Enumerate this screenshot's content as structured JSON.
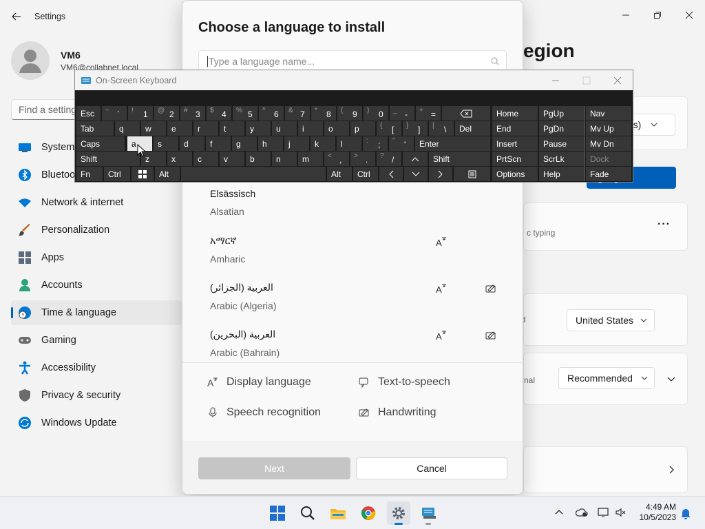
{
  "window": {
    "title": "Settings"
  },
  "user": {
    "name": "VM6",
    "email": "VM6@collabnet.local"
  },
  "search": {
    "placeholder": "Find a setting"
  },
  "sidebar": {
    "items": [
      {
        "label": "System",
        "icon": "system-icon",
        "color": "#0078d4"
      },
      {
        "label": "Bluetooth & devices",
        "icon": "bluetooth-icon",
        "color": "#0078d4"
      },
      {
        "label": "Network & internet",
        "icon": "wifi-icon",
        "color": "#0078d4"
      },
      {
        "label": "Personalization",
        "icon": "brush-icon",
        "color": "#c36a2d"
      },
      {
        "label": "Apps",
        "icon": "apps-icon",
        "color": "#5b6b7b"
      },
      {
        "label": "Accounts",
        "icon": "person-icon",
        "color": "#2ea37a"
      },
      {
        "label": "Time & language",
        "icon": "globe-clock-icon",
        "color": "#0078d4",
        "active": true
      },
      {
        "label": "Gaming",
        "icon": "gamepad-icon",
        "color": "#6b6b6b"
      },
      {
        "label": "Accessibility",
        "icon": "accessibility-icon",
        "color": "#0078d4"
      },
      {
        "label": "Privacy & security",
        "icon": "shield-icon",
        "color": "#6b6b6b"
      },
      {
        "label": "Windows Update",
        "icon": "update-icon",
        "color": "#0078d4"
      }
    ]
  },
  "background": {
    "page_title": "egion",
    "dropdown1": "tes)",
    "add_language_button": "nguage",
    "typing_text": "c typing",
    "country_label": "d",
    "country_value": "United States",
    "format_label": "nal",
    "format_value": "Recommended"
  },
  "dialog": {
    "title": "Choose a language to install",
    "search_placeholder": "Type a language name...",
    "languages": [
      {
        "native": "Elsässisch",
        "english": "Alsatian"
      },
      {
        "native": "አማርኛ",
        "english": "Amharic"
      },
      {
        "native": "العربية (الجزائر)",
        "english": "Arabic (Algeria)"
      },
      {
        "native": "العربية (البحرين)",
        "english": "Arabic (Bahrain)"
      }
    ],
    "features": {
      "display": "Display language",
      "tts": "Text-to-speech",
      "speech": "Speech recognition",
      "handwriting": "Handwriting"
    },
    "next_label": "Next",
    "cancel_label": "Cancel"
  },
  "osk": {
    "title": "On-Screen Keyboard",
    "keys": {
      "esc": "Esc",
      "tab": "Tab",
      "caps": "Caps",
      "shift": "Shift",
      "fn": "Fn",
      "ctrl": "Ctrl",
      "alt": "Alt",
      "enter": "Enter",
      "del": "Del",
      "shift_r": "Shift",
      "alt_r": "Alt",
      "ctrl_r": "Ctrl",
      "home": "Home",
      "pgup": "PgUp",
      "nav": "Nav",
      "end": "End",
      "pgdn": "PgDn",
      "mvup": "Mv Up",
      "insert": "Insert",
      "pause": "Pause",
      "mvdn": "Mv Dn",
      "prtscn": "PrtScn",
      "scrlk": "ScrLk",
      "dock": "Dock",
      "options": "Options",
      "help": "Help",
      "fade": "Fade"
    },
    "number_row": [
      {
        "s": "~",
        "m": "`"
      },
      {
        "s": "!",
        "m": "1"
      },
      {
        "s": "@",
        "m": "2"
      },
      {
        "s": "#",
        "m": "3"
      },
      {
        "s": "$",
        "m": "4"
      },
      {
        "s": "%",
        "m": "5"
      },
      {
        "s": "^",
        "m": "6"
      },
      {
        "s": "&",
        "m": "7"
      },
      {
        "s": "*",
        "m": "8"
      },
      {
        "s": "(",
        "m": "9"
      },
      {
        "s": ")",
        "m": "0"
      },
      {
        "s": "_",
        "m": "-"
      },
      {
        "s": "+",
        "m": "="
      }
    ],
    "row_q": [
      "q",
      "w",
      "e",
      "r",
      "t",
      "y",
      "u",
      "i",
      "o",
      "p"
    ],
    "row_q_extra": [
      {
        "s": "{",
        "m": "["
      },
      {
        "s": "}",
        "m": "]"
      },
      {
        "s": "|",
        "m": "\\"
      }
    ],
    "row_a": [
      "a",
      "s",
      "d",
      "f",
      "g",
      "h",
      "j",
      "k",
      "l"
    ],
    "row_a_extra": [
      {
        "s": ":",
        "m": ";"
      },
      {
        "s": "\"",
        "m": "'"
      }
    ],
    "row_z": [
      "z",
      "x",
      "c",
      "v",
      "b",
      "n",
      "m"
    ],
    "row_z_extra": [
      {
        "s": "<",
        "m": ","
      },
      {
        "s": ">",
        "m": "."
      },
      {
        "s": "?",
        "m": "/"
      }
    ]
  },
  "taskbar": {
    "time": "4:49 AM",
    "date": "10/5/2023",
    "apps": [
      "windows-start-icon",
      "search-icon",
      "file-explorer-icon",
      "chrome-icon",
      "settings-icon",
      "osk-app-icon"
    ]
  }
}
